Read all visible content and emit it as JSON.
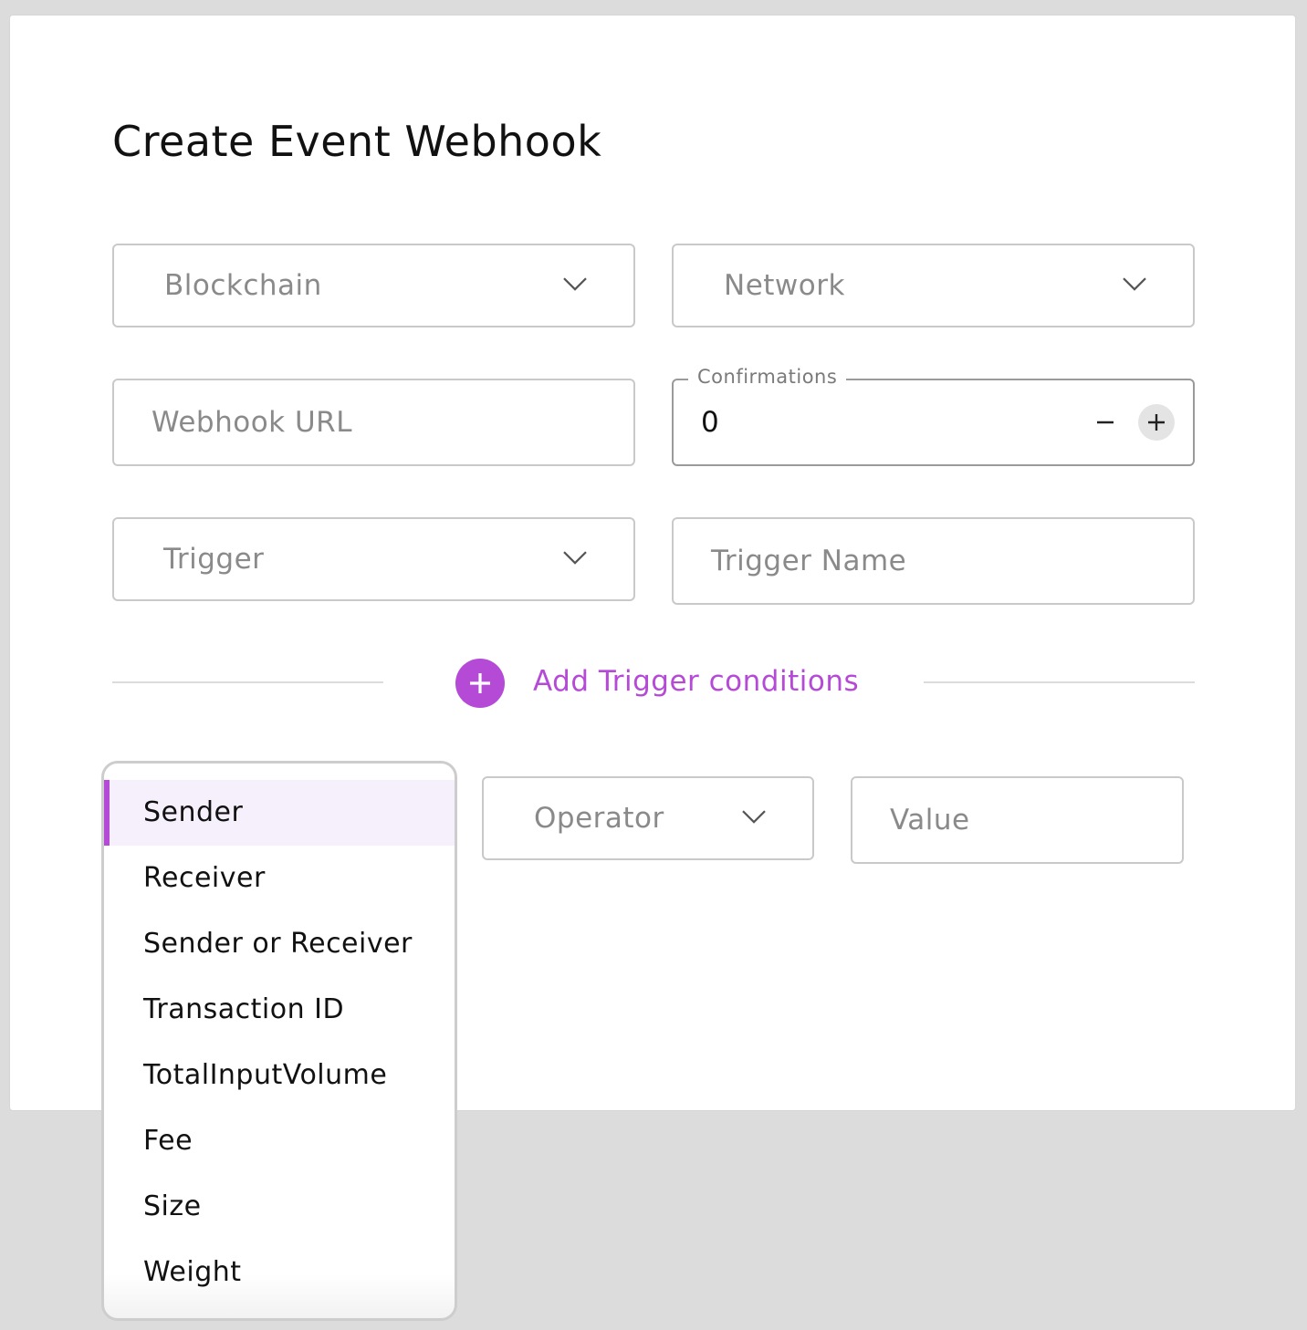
{
  "dialog": {
    "title": "Create Event Webhook",
    "blockchain": {
      "placeholder": "Blockchain",
      "icon": "chevron-down-icon"
    },
    "network": {
      "placeholder": "Network",
      "icon": "chevron-down-icon"
    },
    "webhook_url": {
      "placeholder": "Webhook URL"
    },
    "confirmations": {
      "label": "Confirmations",
      "value": "0",
      "decrement_icon": "minus-icon",
      "increment_icon": "plus-icon"
    },
    "trigger": {
      "placeholder": "Trigger",
      "icon": "chevron-down-icon"
    },
    "trigger_name": {
      "placeholder": "Trigger Name"
    },
    "add_conditions": {
      "label": "Add Trigger conditions",
      "icon": "plus-circle-icon"
    },
    "operator": {
      "placeholder": "Operator",
      "icon": "chevron-down-icon"
    },
    "value": {
      "placeholder": "Value"
    }
  },
  "condition_field_dropdown": {
    "selected": "Sender",
    "options": [
      "Sender",
      "Receiver",
      "Sender or Receiver",
      "Transaction ID",
      "TotalInputVolume",
      "Fee",
      "Size",
      "Weight"
    ]
  },
  "colors": {
    "accent": "#b54ad6",
    "selected_bg": "#f6f0fc",
    "border": "#c9c9c9",
    "placeholder": "#8a8a8a"
  }
}
